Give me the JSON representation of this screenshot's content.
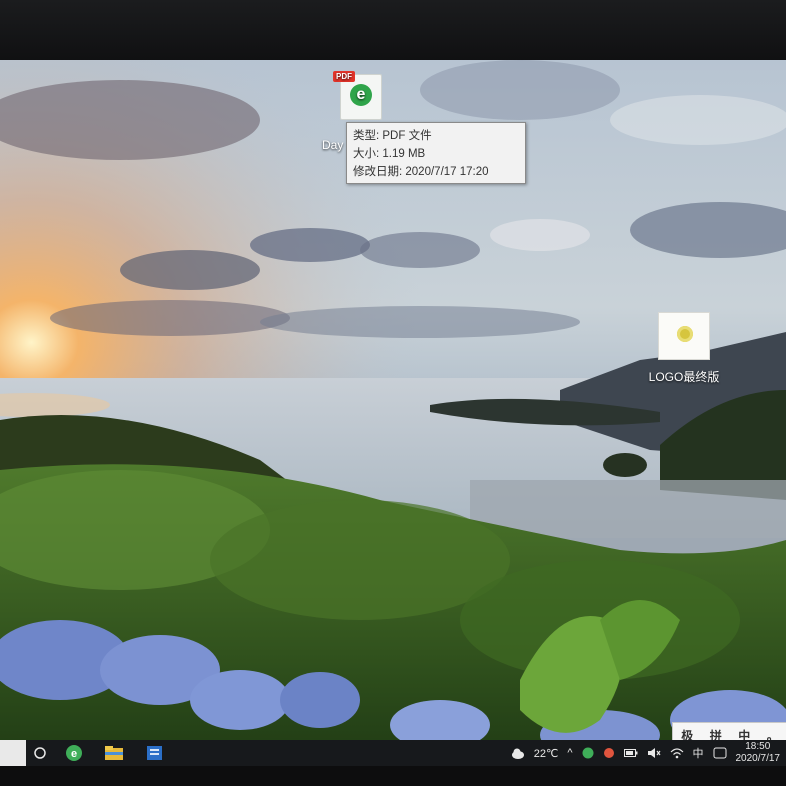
{
  "desktop": {
    "pdf_file": {
      "badge": "PDF",
      "name": "Day"
    },
    "tooltip": {
      "type_line": "类型: PDF 文件",
      "size_line": "大小: 1.19 MB",
      "modified_line": "修改日期: 2020/7/17 17:20"
    },
    "logo_file": {
      "name": "LOGO最终版"
    }
  },
  "ime_bar": {
    "items": [
      "极",
      "拼",
      "中",
      "。"
    ]
  },
  "taskbar": {
    "weather_temp": "22℃",
    "language": "中",
    "time": "18:50",
    "date": "2020/7/17"
  },
  "colors": {
    "taskbar_bg": "#17191c",
    "tooltip_bg": "#f2f2f2",
    "pdf_badge": "#e2342a"
  }
}
